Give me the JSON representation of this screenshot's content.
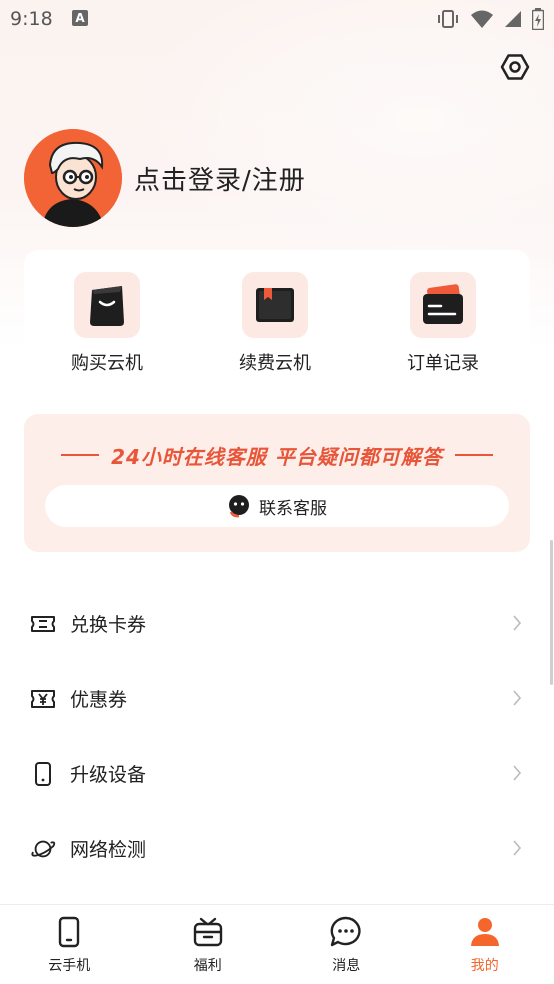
{
  "status_bar": {
    "time": "9:18",
    "notification_letter": "A"
  },
  "profile": {
    "login_text": "点击登录/注册"
  },
  "quick_actions": [
    {
      "label": "购买云机",
      "icon": "shopping-bag-icon"
    },
    {
      "label": "续费云机",
      "icon": "renew-book-icon"
    },
    {
      "label": "订单记录",
      "icon": "order-card-icon"
    }
  ],
  "service": {
    "title": "24小时在线客服 平台疑问都可解答",
    "contact_label": "联系客服"
  },
  "menu": [
    {
      "label": "兑换卡券",
      "icon": "ticket-icon"
    },
    {
      "label": "优惠券",
      "icon": "coupon-yen-icon"
    },
    {
      "label": "升级设备",
      "icon": "phone-device-icon"
    },
    {
      "label": "网络检测",
      "icon": "planet-icon"
    }
  ],
  "tabs": [
    {
      "label": "云手机",
      "icon": "phone-icon",
      "active": false
    },
    {
      "label": "福利",
      "icon": "gift-icon",
      "active": false
    },
    {
      "label": "消息",
      "icon": "chat-bubble-icon",
      "active": false
    },
    {
      "label": "我的",
      "icon": "user-icon",
      "active": true
    }
  ],
  "colors": {
    "accent": "#f4662c",
    "service_red": "#e8563a",
    "icon_bg": "#fde9e4",
    "service_bg": "#feeeea"
  }
}
